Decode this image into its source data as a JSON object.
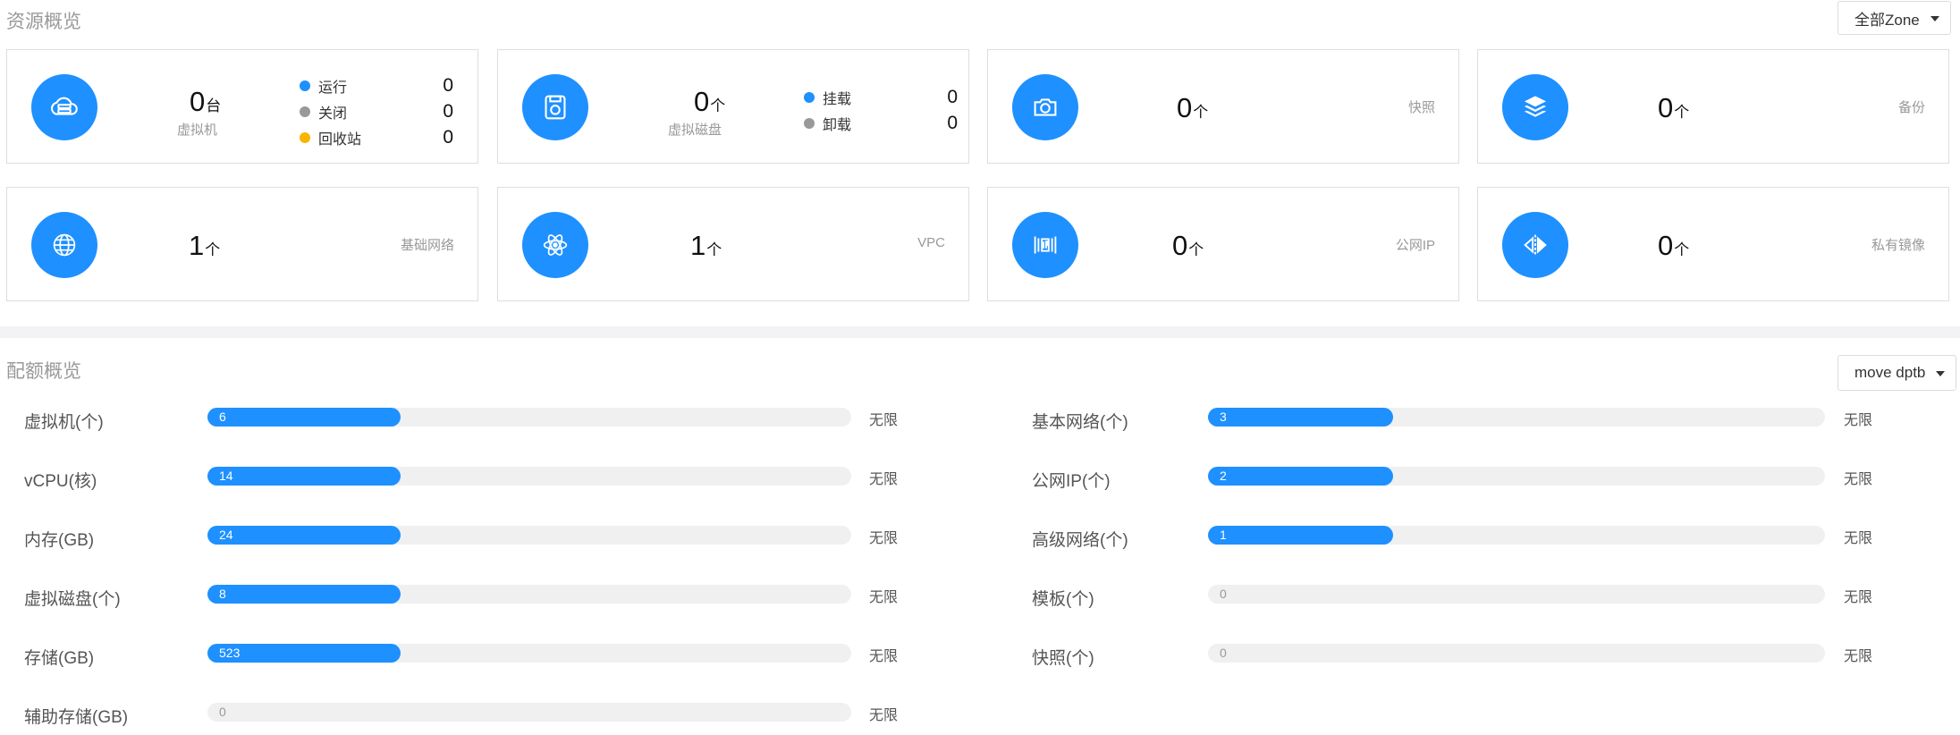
{
  "resources": {
    "title": "资源概览",
    "zone_select": "全部Zone",
    "cards": [
      {
        "name": "vm",
        "icon": "cloud-server-icon",
        "count": "0",
        "unit": "台",
        "label": "虚拟机",
        "status": [
          {
            "label": "运行",
            "value": "0",
            "color": "#1e90ff"
          },
          {
            "label": "关闭",
            "value": "0",
            "color": "#999999"
          },
          {
            "label": "回收站",
            "value": "0",
            "color": "#f7b500"
          }
        ]
      },
      {
        "name": "disk",
        "icon": "disk-icon",
        "count": "0",
        "unit": "个",
        "label": "虚拟磁盘",
        "status": [
          {
            "label": "挂载",
            "value": "0",
            "color": "#1e90ff"
          },
          {
            "label": "卸载",
            "value": "0",
            "color": "#999999"
          }
        ]
      },
      {
        "name": "snapshot",
        "icon": "camera-icon",
        "count": "0",
        "unit": "个",
        "label": "快照"
      },
      {
        "name": "backup",
        "icon": "layers-icon",
        "count": "0",
        "unit": "个",
        "label": "备份"
      },
      {
        "name": "basic-network",
        "icon": "globe-icon",
        "count": "1",
        "unit": "个",
        "label": "基础网络"
      },
      {
        "name": "vpc",
        "icon": "atom-icon",
        "count": "1",
        "unit": "个",
        "label": "VPC"
      },
      {
        "name": "public-ip",
        "icon": "ip-icon",
        "count": "0",
        "unit": "个",
        "label": "公网IP"
      },
      {
        "name": "private-image",
        "icon": "mirror-icon",
        "count": "0",
        "unit": "个",
        "label": "私有镜像"
      }
    ]
  },
  "quota": {
    "title": "配额概览",
    "project_select": "move dptb",
    "left": [
      {
        "label": "虚拟机(个)",
        "value": "6",
        "fill": 0.3,
        "limit": "无限"
      },
      {
        "label": "vCPU(核)",
        "value": "14",
        "fill": 0.3,
        "limit": "无限"
      },
      {
        "label": "内存(GB)",
        "value": "24",
        "fill": 0.3,
        "limit": "无限"
      },
      {
        "label": "虚拟磁盘(个)",
        "value": "8",
        "fill": 0.3,
        "limit": "无限"
      },
      {
        "label": "存储(GB)",
        "value": "523",
        "fill": 0.3,
        "limit": "无限"
      },
      {
        "label": "辅助存储(GB)",
        "value": "0",
        "fill": 0,
        "limit": "无限"
      }
    ],
    "right": [
      {
        "label": "基本网络(个)",
        "value": "3",
        "fill": 0.3,
        "limit": "无限"
      },
      {
        "label": "公网IP(个)",
        "value": "2",
        "fill": 0.3,
        "limit": "无限"
      },
      {
        "label": "高级网络(个)",
        "value": "1",
        "fill": 0.3,
        "limit": "无限"
      },
      {
        "label": "模板(个)",
        "value": "0",
        "fill": 0,
        "limit": "无限"
      },
      {
        "label": "快照(个)",
        "value": "0",
        "fill": 0,
        "limit": "无限"
      }
    ]
  }
}
